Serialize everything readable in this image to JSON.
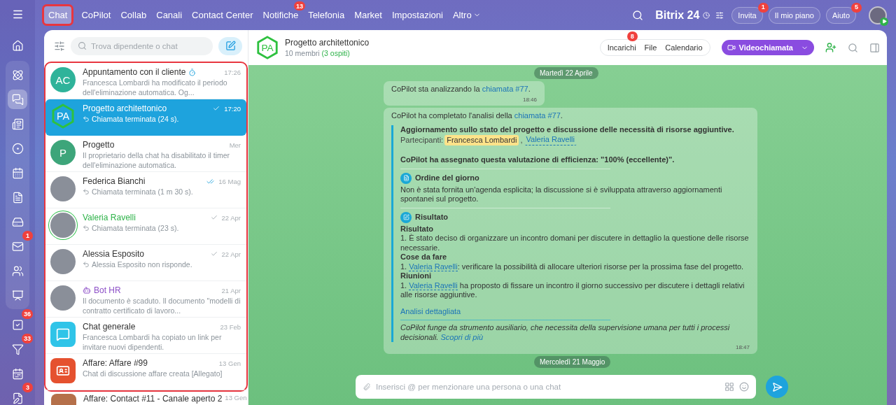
{
  "top_nav": {
    "items": [
      {
        "label": "Chat",
        "selected": true,
        "highlighted": true
      },
      {
        "label": "CoPilot",
        "selected": false,
        "highlighted": false
      },
      {
        "label": "Collab",
        "selected": false,
        "highlighted": false
      },
      {
        "label": "Canali",
        "selected": false,
        "highlighted": false
      },
      {
        "label": "Contact Center",
        "selected": false,
        "highlighted": false
      },
      {
        "label": "Notifiche",
        "selected": false,
        "highlighted": false,
        "badge": "13"
      },
      {
        "label": "Telefonia",
        "selected": false,
        "highlighted": false
      },
      {
        "label": "Market",
        "selected": false,
        "highlighted": false
      },
      {
        "label": "Impostazioni",
        "selected": false,
        "highlighted": false
      }
    ],
    "more": "Altro",
    "brand": "Bitrix",
    "brand_suffix": "24",
    "buttons": [
      {
        "label": "Invita",
        "badge": "1"
      },
      {
        "label": "Il mio piano"
      },
      {
        "label": "Aiuto",
        "badge": "5"
      }
    ]
  },
  "rail": {
    "items": [
      {
        "kind": "home",
        "selected": false
      },
      {
        "kind": "copilot",
        "selected": false
      },
      {
        "kind": "chat",
        "selected": true
      },
      {
        "kind": "feed",
        "selected": false
      },
      {
        "kind": "target",
        "selected": false
      },
      {
        "kind": "calendar",
        "selected": false
      },
      {
        "kind": "document",
        "selected": false
      },
      {
        "kind": "drive",
        "selected": false
      },
      {
        "kind": "mail",
        "selected": false,
        "badge": "1"
      },
      {
        "kind": "people",
        "selected": false
      },
      {
        "kind": "board",
        "selected": false
      },
      {
        "kind": "tasks",
        "selected": false,
        "badge": "36"
      },
      {
        "kind": "funnel",
        "selected": false,
        "badge": "33"
      },
      {
        "kind": "planner",
        "selected": false
      },
      {
        "kind": "sign",
        "selected": false,
        "badge": "3"
      }
    ]
  },
  "chat_list": {
    "search_placeholder": "Trova dipendente o chat",
    "highlighted": true,
    "chats": [
      {
        "title": "Appuntamento con il cliente",
        "kind": "group",
        "timer": true,
        "time": "17:26",
        "preview": "Francesca Lombardi ha modificato il periodo dell'eliminazione automatica. Og...",
        "selected": false,
        "avatar": {
          "kind": "initials",
          "initials": "AC",
          "color": "#2fb39a"
        }
      },
      {
        "title": "Progetto architettonico",
        "kind": "group",
        "time": "17:20",
        "read": false,
        "call": true,
        "preview": "Chiamata terminata (24 s).",
        "selected": true,
        "avatar": {
          "kind": "hexagon",
          "initials": "PA",
          "color": "#2ec13f"
        }
      },
      {
        "title": "Progetto",
        "kind": "group",
        "time": "Mer",
        "preview": "Il proprietario della chat ha disabilitato il timer dell'eliminazione automatica.",
        "selected": false,
        "avatar": {
          "kind": "initials",
          "initials": "P",
          "color": "#3da57a"
        }
      },
      {
        "title": "Federica Bianchi",
        "kind": "user",
        "time": "16 Mag",
        "read": true,
        "call": true,
        "preview": "Chiamata terminata (1 m 30 s).",
        "selected": false,
        "avatar": {
          "kind": "photo"
        }
      },
      {
        "title": "Valeria Ravelli",
        "kind": "online",
        "time": "22 Apr",
        "read": false,
        "call": true,
        "preview": "Chiamata terminata (23 s).",
        "selected": false,
        "avatar": {
          "kind": "photo"
        }
      },
      {
        "title": "Alessia Esposito",
        "kind": "user",
        "time": "22 Apr",
        "read": false,
        "call": true,
        "preview": "Alessia Esposito non risponde.",
        "selected": false,
        "avatar": {
          "kind": "photo"
        }
      },
      {
        "title": "Bot HR",
        "kind": "bot",
        "time": "21 Apr",
        "preview": "Il documento è scaduto. Il documento \"modelli di contratto certificato di lavoro...",
        "selected": false,
        "avatar": {
          "kind": "photo"
        }
      },
      {
        "title": "Chat generale",
        "kind": "group",
        "time": "23 Feb",
        "preview": "Francesca Lombardi ha copiato un link per invitare nuovi dipendenti.",
        "selected": false,
        "avatar": {
          "kind": "general",
          "color": "#2fc4e8"
        }
      },
      {
        "title": "Affare: Affare #99",
        "kind": "group",
        "time": "13 Gen",
        "preview": "Chat di discussione affare creata [Allegato]",
        "selected": false,
        "avatar": {
          "kind": "deal",
          "color": "#e5512f"
        }
      }
    ],
    "partial_chat": {
      "title": "Affare: Contact #11 - Canale aperto 2",
      "time": "13 Gen"
    }
  },
  "chat": {
    "title": "Progetto architettonico",
    "avatar": {
      "kind": "hexagon",
      "initials": "PA",
      "color": "#2ec13f"
    },
    "members": "10 membri",
    "guests": "(3 ospiti)",
    "tabs": [
      {
        "label": "Incarichi",
        "badge": "8"
      },
      {
        "label": "File"
      },
      {
        "label": "Calendario"
      }
    ],
    "call_button": "Videochiamata",
    "messages": [
      {
        "kind": "date",
        "text": "Martedì 22 Aprile"
      },
      {
        "kind": "simple",
        "time": "18:46",
        "parts": [
          {
            "kind": "plain",
            "text": "CoPilot sta analizzando la "
          },
          {
            "kind": "link",
            "text": "chiamata #77"
          },
          {
            "kind": "plain",
            "text": "."
          }
        ]
      },
      {
        "kind": "report",
        "time": "18:47",
        "parts": [
          {
            "kind": "plain",
            "text": "CoPilot ha completato l'analisi della "
          },
          {
            "kind": "link",
            "text": "chiamata #77"
          },
          {
            "kind": "plain",
            "text": "."
          }
        ],
        "title": "Aggiornamento sullo stato del progetto e discussione delle necessità di risorse aggiuntive.",
        "participants_label": "Partecipanti:",
        "separator": ",",
        "participants": [
          {
            "name": "Francesca Lombardi",
            "highlighted": true
          },
          {
            "name": "Valeria Ravelli",
            "highlighted": false
          }
        ],
        "rating": "CoPilot ha assegnato questa valutazione di efficienza: \"100% (eccellente)\".",
        "sections": [
          {
            "kind": "agenda",
            "heading": "Ordine del giorno",
            "blocks": [
              {
                "items": [
                  [
                    {
                      "kind": "plain",
                      "text": "Non è stata fornita un'agenda esplicita; la discussione si è sviluppata attraverso aggiornamenti spontanei sul progetto."
                    }
                  ]
                ]
              }
            ]
          },
          {
            "kind": "result",
            "heading": "Risultato",
            "blocks": [
              {
                "subheading": "Risultato",
                "items": [
                  [
                    {
                      "kind": "plain",
                      "text": "1. È stato deciso di organizzare un incontro domani per discutere in dettaglio la questione delle risorse necessarie."
                    }
                  ]
                ]
              },
              {
                "subheading": "Cose da fare",
                "items": [
                  [
                    {
                      "kind": "plain",
                      "text": "1. "
                    },
                    {
                      "kind": "mention",
                      "text": "Valeria Ravelli"
                    },
                    {
                      "kind": "plain",
                      "text": ": verificare la possibilità di allocare ulteriori risorse per la prossima fase del progetto."
                    }
                  ]
                ]
              },
              {
                "subheading": "Riunioni",
                "items": [
                  [
                    {
                      "kind": "plain",
                      "text": "1. "
                    },
                    {
                      "kind": "mention",
                      "text": "Valeria Ravelli"
                    },
                    {
                      "kind": "plain",
                      "text": " ha proposto di fissare un incontro il giorno successivo per discutere i dettagli relativi alle risorse aggiuntive."
                    }
                  ]
                ]
              }
            ]
          }
        ],
        "details_link": "Analisi dettagliata",
        "disclaimer": [
          {
            "kind": "plain",
            "text": "CoPilot funge da strumento ausiliario, che necessita della supervisione umana per tutti i processi decisionali. "
          },
          {
            "kind": "link",
            "text": "Scopri di più"
          }
        ]
      },
      {
        "kind": "date",
        "text": "Mercoledì 21 Maggio"
      }
    ],
    "composer_placeholder": "Inserisci @ per menzionare una persona o una chat"
  }
}
